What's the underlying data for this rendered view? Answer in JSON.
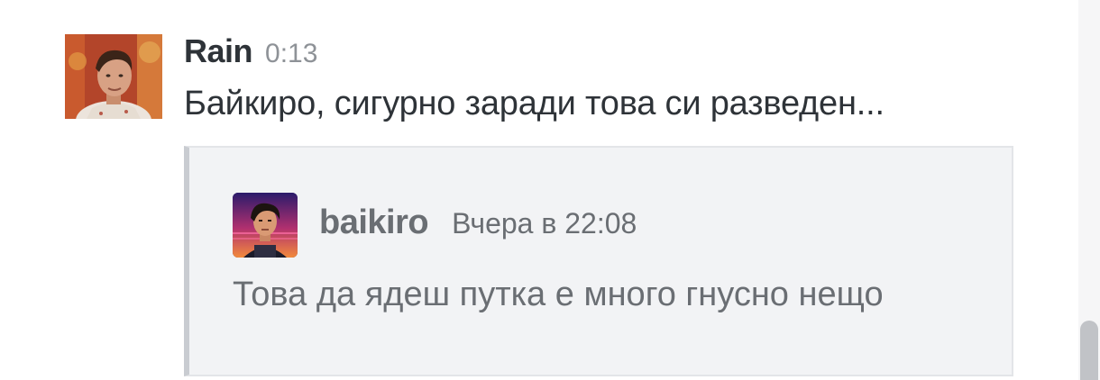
{
  "message": {
    "author": "Rain",
    "timestamp": "0:13",
    "text": "Байкиро, сигурно заради това си разведен...",
    "avatar_icon": "user-photo-avatar"
  },
  "quote": {
    "author": "baikiro",
    "timestamp": "Вчера в 22:08",
    "text": "Това да ядеш путка е много гнусно нещо",
    "avatar_icon": "pixel-art-avatar"
  },
  "colors": {
    "author_text": "#2e3338",
    "muted_text": "#8e9297",
    "quote_background": "#f2f3f5",
    "quote_border": "#c9ccd1",
    "quote_text": "#6a6e73"
  }
}
